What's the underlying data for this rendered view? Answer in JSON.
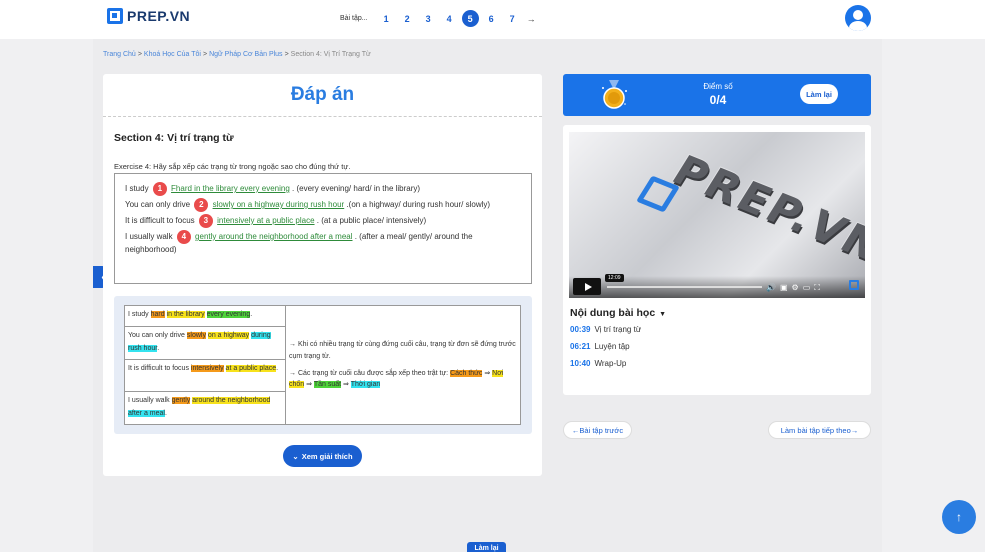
{
  "header": {
    "logo_text": "PREP.VN",
    "pager": {
      "label": "Bài tập...",
      "pages": [
        "1",
        "2",
        "3",
        "4",
        "5",
        "6",
        "7"
      ],
      "active_page": "5",
      "next_arrow": "→"
    }
  },
  "breadcrumb": {
    "items": [
      "Trang Chủ",
      "Khoá Học Của Tôi",
      "Ngữ Pháp Cơ Bản Plus"
    ],
    "current": "Section 4: Vị Trí Trạng Từ",
    "separator": ">"
  },
  "answer": {
    "title": "Đáp án",
    "section_title": "Section 4: Vị trí trạng từ",
    "instruction": "Exercise 4: Hãy sắp xếp các trạng từ trong ngoặc sao cho đúng thứ tự.",
    "questions": [
      {
        "num": "1",
        "prefix": "I study",
        "answer": "Fhard in the library every evening",
        "suffix": ". (every evening/ hard/ in the library)"
      },
      {
        "num": "2",
        "prefix": "You can only drive",
        "answer": "slowly on a highway during rush hour",
        "suffix": ".(on a highway/ during rush hour/ slowly)"
      },
      {
        "num": "3",
        "prefix": "It is difficult to focus",
        "answer": "intensively at a public place",
        "suffix": ". (at a public place/ intensively)"
      },
      {
        "num": "4",
        "prefix": "I usually walk",
        "answer": "gently around the neighborhood after a meal",
        "suffix": ". (after a meal/ gently/ around the neighborhood)"
      }
    ]
  },
  "explanation": {
    "rows": [
      {
        "t1": "I study ",
        "h1": "hard",
        "t2": " ",
        "h2": "in the library",
        "t3": " ",
        "h3": "every evening",
        "t4": "."
      },
      {
        "t1": "You can only drive ",
        "h1": "slowly",
        "t2": " ",
        "h2": "on a highway",
        "t3": " ",
        "h3": "during rush hour",
        "t4": "."
      },
      {
        "t1": "It is difficult to focus ",
        "h1": "intensively",
        "t2": " ",
        "h2": "at a public place",
        "t3": "",
        "h3": "",
        "t4": "."
      },
      {
        "t1": "I usually walk ",
        "h1": "gently",
        "t2": " ",
        "h2": "around the neighborhood",
        "t3": " ",
        "h3": "after a meal",
        "t4": "."
      }
    ],
    "rule1": "→ Khi có nhiều trạng từ cùng đứng cuối câu, trạng từ đơn sẽ đứng trước cụm trạng từ.",
    "rule2_prefix": "→ Các trạng từ cuối câu được sắp xếp theo trật tự: ",
    "rule2_manner": "Cách thức",
    "rule2_place": "Nơi chốn",
    "rule2_freq": "Tần suất",
    "rule2_time": "Thời gian",
    "rule2_arrow": "⇒",
    "button_label": "Xem giải thích"
  },
  "score": {
    "label": "Điểm số",
    "value": "0/4",
    "retry_label": "Làm lại"
  },
  "video": {
    "timestamp": "12:09",
    "watermark": "PREP.VN"
  },
  "lesson": {
    "title": "Nội dung bài học",
    "items": [
      {
        "time": "00:39",
        "name": "Vị trí trạng từ"
      },
      {
        "time": "06:21",
        "name": "Luyện tập"
      },
      {
        "time": "10:40",
        "name": "Wrap-Up"
      }
    ]
  },
  "nav": {
    "prev_label": "←Bài tập trước",
    "next_label": "Làm bài tập tiếp theo→"
  },
  "footer": {
    "retry_label": "Làm lại"
  },
  "colors": {
    "primary": "#1a5fd0",
    "accent": "#2a7de1",
    "badge": "#e94b4b",
    "correct": "#2e8b3a",
    "highlight_orange": "#f59a1a",
    "highlight_yellow": "#f7e21c",
    "highlight_green": "#4fd43a",
    "highlight_cyan": "#34e3ef"
  }
}
